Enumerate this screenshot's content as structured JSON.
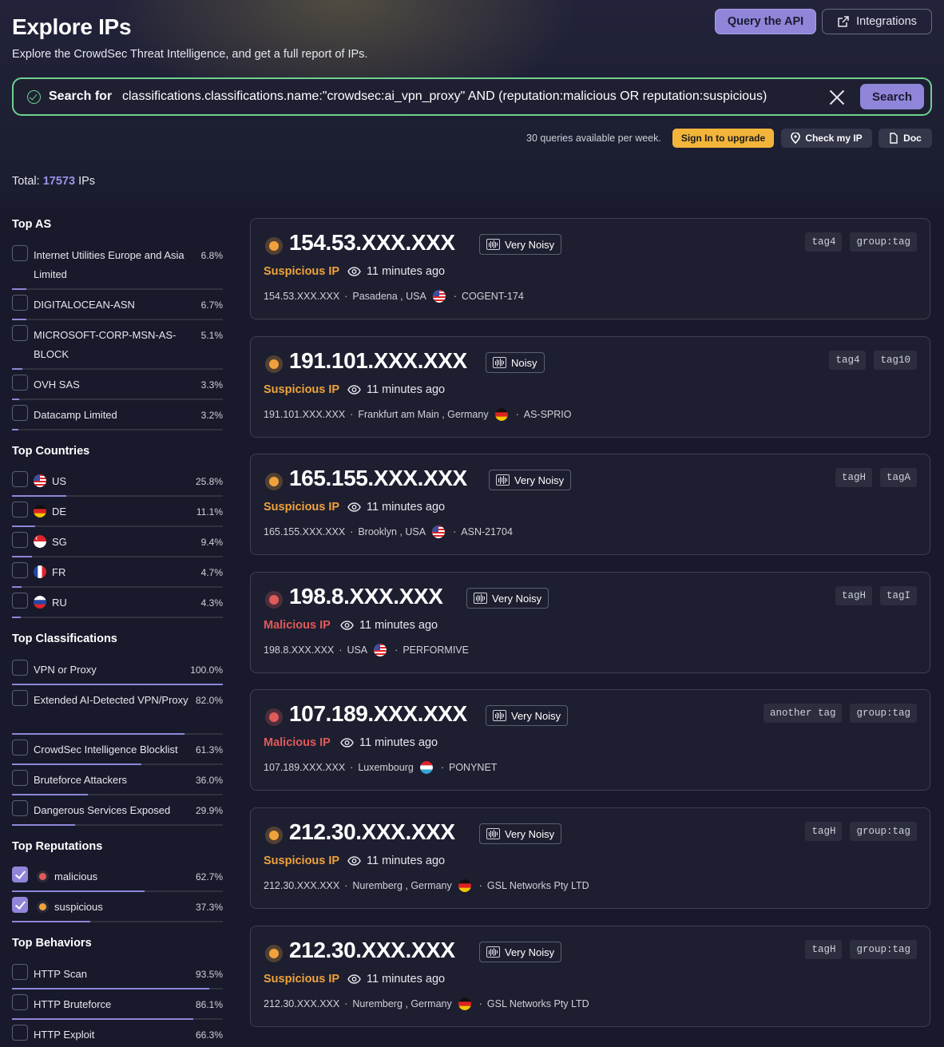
{
  "header": {
    "title": "Explore IPs",
    "subtitle": "Explore the CrowdSec Threat Intelligence, and get a full report of IPs.",
    "query_api_label": "Query the API",
    "integrations_label": "Integrations"
  },
  "search": {
    "label": "Search for",
    "query": "classifications.classifications.name:\"crowdsec:ai_vpn_proxy\" AND (reputation:malicious OR reputation:suspicious)",
    "button": "Search"
  },
  "toolbar": {
    "quota": "30 queries available per week.",
    "signin_label": "Sign In to upgrade",
    "check_ip_label": "Check my IP",
    "doc_label": "Doc"
  },
  "total": {
    "prefix": "Total:",
    "count": "17573",
    "suffix": "IPs"
  },
  "filters": {
    "top_as": {
      "title": "Top AS",
      "items": [
        {
          "label": "Internet Utilities Europe and Asia Limited",
          "pct": "6.8%",
          "value": 6.8,
          "checked": false
        },
        {
          "label": "DIGITALOCEAN-ASN",
          "pct": "6.7%",
          "value": 6.7,
          "checked": false
        },
        {
          "label": "MICROSOFT-CORP-MSN-AS-BLOCK",
          "pct": "5.1%",
          "value": 5.1,
          "checked": false
        },
        {
          "label": "OVH SAS",
          "pct": "3.3%",
          "value": 3.3,
          "checked": false
        },
        {
          "label": "Datacamp Limited",
          "pct": "3.2%",
          "value": 3.2,
          "checked": false
        }
      ]
    },
    "top_countries": {
      "title": "Top Countries",
      "items": [
        {
          "label": "US",
          "pct": "25.8%",
          "value": 25.8,
          "flag": "us-flag-icon",
          "checked": false
        },
        {
          "label": "DE",
          "pct": "11.1%",
          "value": 11.1,
          "flag": "de-flag-icon",
          "checked": false
        },
        {
          "label": "SG",
          "pct": "9.4%",
          "value": 9.4,
          "flag": "sg-flag-icon",
          "checked": false
        },
        {
          "label": "FR",
          "pct": "4.7%",
          "value": 4.7,
          "flag": "fr-flag-icon",
          "checked": false
        },
        {
          "label": "RU",
          "pct": "4.3%",
          "value": 4.3,
          "flag": "ru-flag-icon",
          "checked": false
        }
      ]
    },
    "top_classifications": {
      "title": "Top Classifications",
      "items": [
        {
          "label": "VPN or Proxy",
          "pct": "100.0%",
          "value": 100.0,
          "checked": false
        },
        {
          "label": "Extended AI-Detected VPN/Proxy",
          "pct": "82.0%",
          "value": 82.0,
          "checked": false
        },
        {
          "label": "CrowdSec Intelligence Blocklist",
          "pct": "61.3%",
          "value": 61.3,
          "checked": false
        },
        {
          "label": "Bruteforce Attackers",
          "pct": "36.0%",
          "value": 36.0,
          "checked": false
        },
        {
          "label": "Dangerous Services Exposed",
          "pct": "29.9%",
          "value": 29.9,
          "checked": false
        }
      ]
    },
    "top_reputations": {
      "title": "Top Reputations",
      "items": [
        {
          "label": "malicious",
          "pct": "62.7%",
          "value": 62.7,
          "checked": true,
          "color": "#e05a5a"
        },
        {
          "label": "suspicious",
          "pct": "37.3%",
          "value": 37.3,
          "checked": true,
          "color": "#f0a23a"
        }
      ]
    },
    "top_behaviors": {
      "title": "Top Behaviors",
      "items": [
        {
          "label": "HTTP Scan",
          "pct": "93.5%",
          "value": 93.5,
          "checked": false
        },
        {
          "label": "HTTP Bruteforce",
          "pct": "86.1%",
          "value": 86.1,
          "checked": false
        },
        {
          "label": "HTTP Exploit",
          "pct": "66.3%",
          "value": 66.3,
          "checked": false
        }
      ]
    }
  },
  "colors": {
    "accent": "#8f86d9",
    "suspicious": "#f0a23a",
    "malicious": "#e05a5a",
    "search_border": "#6fd08f",
    "upgrade": "#f2b53a"
  },
  "results": [
    {
      "ip": "154.53.XXX.XXX",
      "noise": "Very Noisy",
      "status": "Suspicious IP",
      "status_kind": "suspicious",
      "time": "11 minutes ago",
      "meta_ip": "154.53.XXX.XXX",
      "location": "Pasadena , USA",
      "flag": "us-flag-icon",
      "asn": "COGENT-174",
      "tags": [
        "tag4",
        "group:tag"
      ]
    },
    {
      "ip": "191.101.XXX.XXX",
      "noise": "Noisy",
      "status": "Suspicious IP",
      "status_kind": "suspicious",
      "time": "11 minutes ago",
      "meta_ip": "191.101.XXX.XXX",
      "location": "Frankfurt am Main , Germany",
      "flag": "de-flag-icon",
      "asn": "AS-SPRIO",
      "tags": [
        "tag4",
        "tag10"
      ]
    },
    {
      "ip": "165.155.XXX.XXX",
      "noise": "Very Noisy",
      "status": "Suspicious IP",
      "status_kind": "suspicious",
      "time": "11 minutes ago",
      "meta_ip": "165.155.XXX.XXX",
      "location": "Brooklyn , USA",
      "flag": "us-flag-icon",
      "asn": "ASN-21704",
      "tags": [
        "tagH",
        "tagA"
      ]
    },
    {
      "ip": "198.8.XXX.XXX",
      "noise": "Very Noisy",
      "status": "Malicious IP",
      "status_kind": "malicious",
      "time": "11 minutes ago",
      "meta_ip": "198.8.XXX.XXX",
      "location": "USA",
      "flag": "us-flag-icon",
      "asn": "PERFORMIVE",
      "tags": [
        "tagH",
        "tagI"
      ]
    },
    {
      "ip": "107.189.XXX.XXX",
      "noise": "Very Noisy",
      "status": "Malicious IP",
      "status_kind": "malicious",
      "time": "11 minutes ago",
      "meta_ip": "107.189.XXX.XXX",
      "location": "Luxembourg",
      "flag": "lu-flag-icon",
      "asn": "PONYNET",
      "tags": [
        "another tag",
        "group:tag"
      ]
    },
    {
      "ip": "212.30.XXX.XXX",
      "noise": "Very Noisy",
      "status": "Suspicious IP",
      "status_kind": "suspicious",
      "time": "11 minutes ago",
      "meta_ip": "212.30.XXX.XXX",
      "location": "Nuremberg , Germany",
      "flag": "de-flag-icon",
      "asn": "GSL Networks Pty LTD",
      "tags": [
        "tagH",
        "group:tag"
      ]
    },
    {
      "ip": "212.30.XXX.XXX",
      "noise": "Very Noisy",
      "status": "Suspicious IP",
      "status_kind": "suspicious",
      "time": "11 minutes ago",
      "meta_ip": "212.30.XXX.XXX",
      "location": "Nuremberg , Germany",
      "flag": "de-flag-icon",
      "asn": "GSL Networks Pty LTD",
      "tags": [
        "tagH",
        "group:tag"
      ]
    }
  ]
}
